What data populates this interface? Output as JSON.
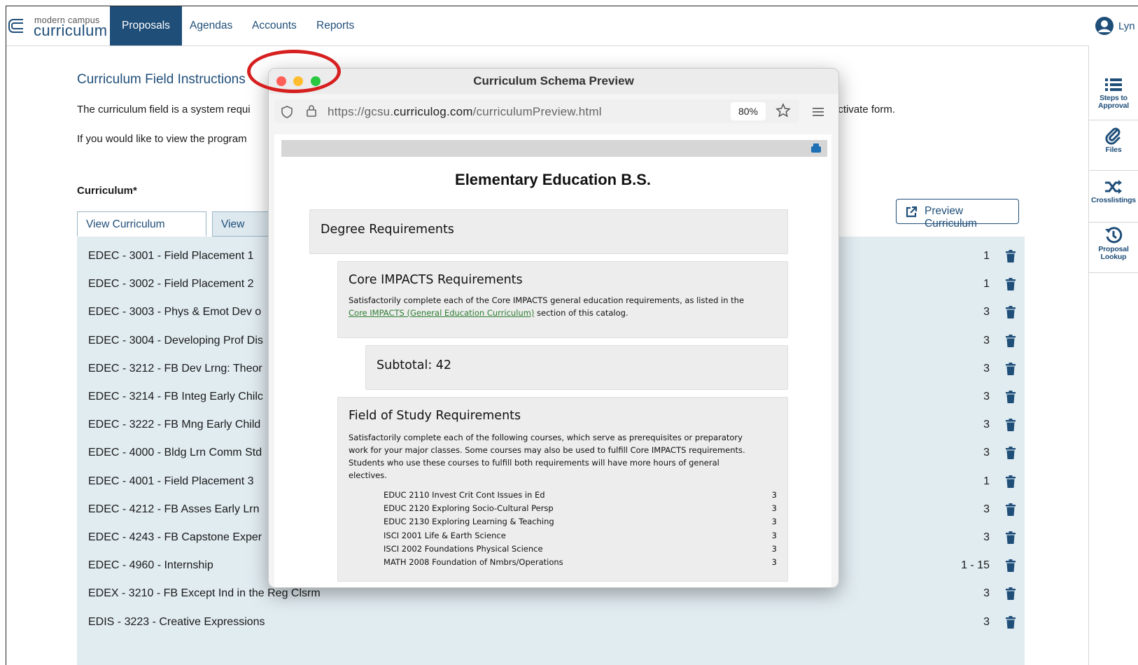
{
  "app": {
    "logo_small": "modern campus",
    "logo_big": "curriculum",
    "nav": [
      "Proposals",
      "Agendas",
      "Accounts",
      "Reports"
    ],
    "user_name": "Lyn"
  },
  "tools": [
    {
      "label1": "Steps to",
      "label2": "Approval",
      "icon": "list-icon"
    },
    {
      "label1": "Files",
      "label2": "",
      "icon": "paperclip-icon"
    },
    {
      "label1": "Crosslistings",
      "label2": "",
      "icon": "shuffle-icon"
    },
    {
      "label1": "Proposal",
      "label2": "Lookup",
      "icon": "history-icon"
    }
  ],
  "main": {
    "heading": "Curriculum Field Instructions",
    "para1_left": "The curriculum field is a system requi",
    "para1_right": "activate form.",
    "para2": "If you would like to view the program",
    "curriculum_label": "Curriculum*",
    "tab_courses": "View Curriculum Courses",
    "tab_curriculum": "View Curr",
    "preview_button": "Preview Curriculum"
  },
  "courses": [
    {
      "name": "EDEC - 3001 - Field Placement 1",
      "credits": "1"
    },
    {
      "name": "EDEC - 3002 - Field Placement 2",
      "credits": "1"
    },
    {
      "name": "EDEC - 3003 - Phys & Emot Dev o",
      "credits": "3"
    },
    {
      "name": "EDEC - 3004 - Developing Prof Dis",
      "credits": "3"
    },
    {
      "name": "EDEC - 3212 - FB Dev Lrng: Theor",
      "credits": "3"
    },
    {
      "name": "EDEC - 3214 - FB Integ Early Chilc",
      "credits": "3"
    },
    {
      "name": "EDEC - 3222 - FB Mng Early Child",
      "credits": "3"
    },
    {
      "name": "EDEC - 4000 - Bldg Lrn Comm Std",
      "credits": "3"
    },
    {
      "name": "EDEC - 4001 - Field Placement 3",
      "credits": "1"
    },
    {
      "name": "EDEC - 4212 - FB Asses Early Lrn",
      "credits": "3"
    },
    {
      "name": "EDEC - 4243 - FB Capstone Exper",
      "credits": "3"
    },
    {
      "name": "EDEC - 4960 - Internship",
      "credits": "1 - 15"
    },
    {
      "name": "EDEX - 3210 - FB Except Ind in the Reg Clsrm",
      "credits": "3"
    },
    {
      "name": "EDIS - 3223 - Creative Expressions",
      "credits": "3"
    }
  ],
  "popup": {
    "window_title": "Curriculum Schema Preview",
    "url_prefix": "https://gcsu.",
    "url_domain": "curriculog.com",
    "url_path": "/curriculumPreview.html",
    "zoom": "80%",
    "doc_title": "Elementary Education B.S.",
    "degree_req": "Degree Requirements",
    "core_title": "Core IMPACTS Requirements",
    "core_text1": "Satisfactorily complete each of the Core IMPACTS general education requirements, as listed in the",
    "core_link": "Core IMPACTS (General Education Curriculum)",
    "core_text2": " section of this catalog.",
    "subtotal": "Subtotal: 42",
    "fos_title": "Field of Study Requirements",
    "fos_lines": [
      "Satisfactorily complete each of the following courses, which serve as prerequisites or preparatory",
      "work for your major classes. Some courses may also be used to fulfill Core IMPACTS requirements.",
      "Students who use these courses to fulfill both requirements will have more hours of general",
      "electives."
    ],
    "fos_courses": [
      {
        "name": "EDUC 2110 Invest Crit Cont Issues in Ed",
        "credits": "3"
      },
      {
        "name": "EDUC 2120 Exploring Socio-Cultural Persp",
        "credits": "3"
      },
      {
        "name": "EDUC 2130 Exploring Learning & Teaching",
        "credits": "3"
      },
      {
        "name": "ISCI 2001 Life & Earth Science",
        "credits": "3"
      },
      {
        "name": "ISCI 2002 Foundations Physical Science",
        "credits": "3"
      },
      {
        "name": "MATH 2008 Foundation of Nmbrs/Operations",
        "credits": "3"
      }
    ]
  },
  "colors": {
    "brand": "#1f4e79",
    "traffic_red": "#ff5f57",
    "traffic_yellow": "#febc2e",
    "traffic_green": "#28c840",
    "highlight_ring": "#d61f1f"
  }
}
